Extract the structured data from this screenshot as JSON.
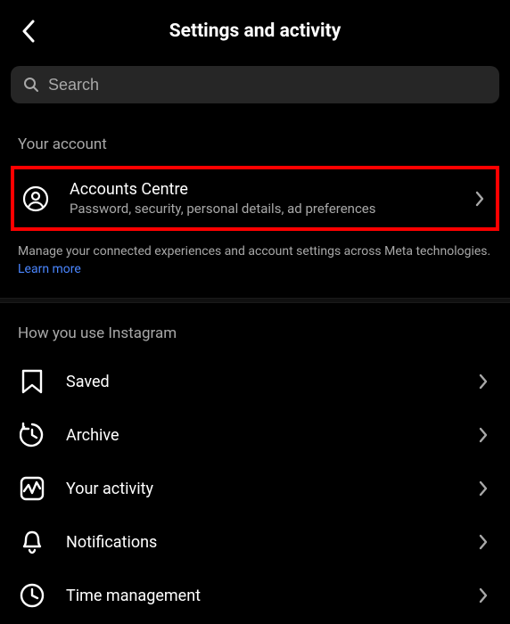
{
  "header": {
    "title": "Settings and activity"
  },
  "search": {
    "placeholder": "Search"
  },
  "account": {
    "section_label": "Your account",
    "item": {
      "title": "Accounts Centre",
      "subtitle": "Password, security, personal details, ad preferences"
    },
    "meta_note_prefix": "Manage your connected experiences and account settings across Meta technologies. ",
    "meta_note_link": "Learn more"
  },
  "usage": {
    "section_label": "How you use Instagram",
    "items": [
      {
        "label": "Saved"
      },
      {
        "label": "Archive"
      },
      {
        "label": "Your activity"
      },
      {
        "label": "Notifications"
      },
      {
        "label": "Time management"
      }
    ]
  }
}
